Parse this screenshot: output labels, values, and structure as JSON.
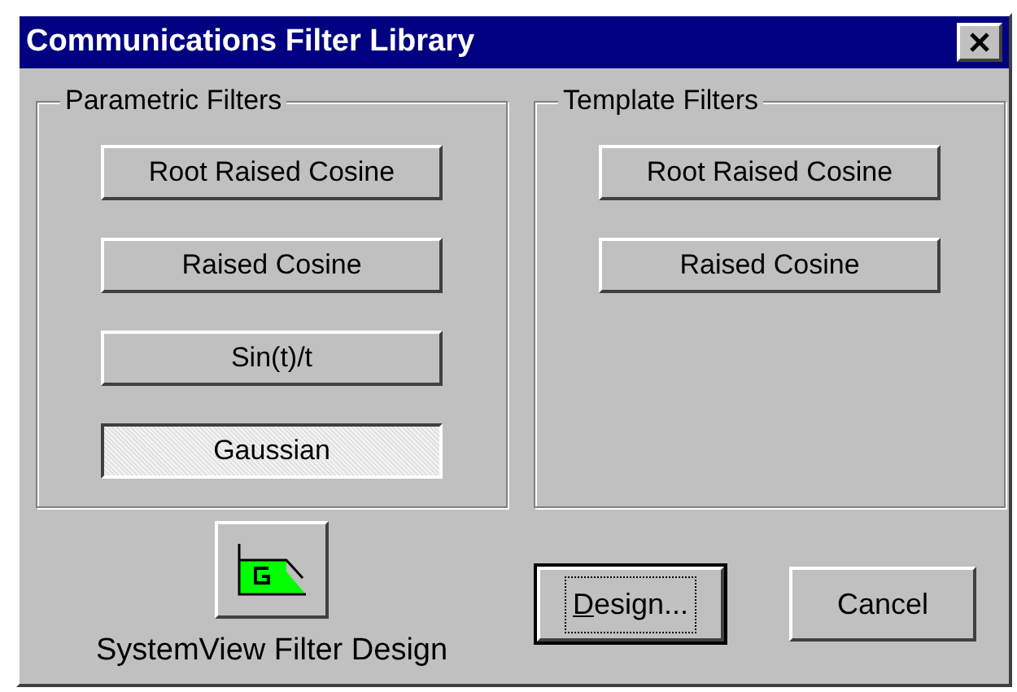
{
  "window": {
    "title": "Communications Filter Library"
  },
  "groups": [
    {
      "title": "Parametric Filters",
      "buttons": [
        {
          "label": "Root Raised Cosine",
          "selected": false
        },
        {
          "label": "Raised Cosine",
          "selected": false
        },
        {
          "label": "Sin(t)/t",
          "selected": false
        },
        {
          "label": "Gaussian",
          "selected": true
        }
      ]
    },
    {
      "title": "Template Filters",
      "buttons": [
        {
          "label": "Root Raised Cosine",
          "selected": false
        },
        {
          "label": "Raised Cosine",
          "selected": false
        }
      ]
    }
  ],
  "tool": {
    "label": "SystemView Filter Design"
  },
  "actions": [
    {
      "label": "Design...",
      "default": true,
      "underline_first": true
    },
    {
      "label": "Cancel",
      "default": false,
      "underline_first": false
    }
  ]
}
